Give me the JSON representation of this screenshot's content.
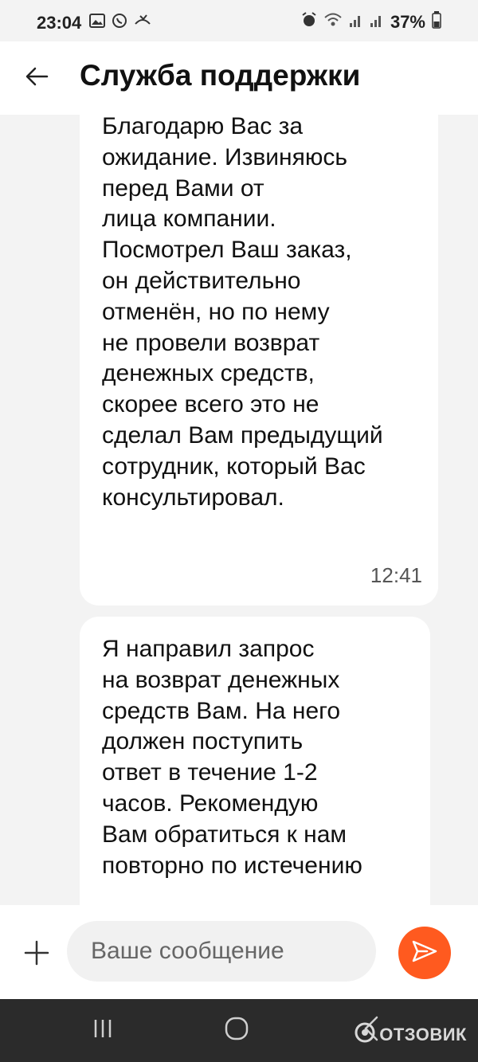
{
  "status_bar": {
    "time": "23:04",
    "battery": "37%",
    "icons_left": [
      "gallery-icon",
      "whatsapp-icon",
      "missed-call-icon"
    ],
    "icons_right": [
      "alarm-icon",
      "wifi-icon",
      "signal-icon",
      "signal-icon",
      "battery-icon"
    ]
  },
  "header": {
    "title": "Служба поддержки",
    "back_icon": "arrow-left-icon"
  },
  "messages": [
    {
      "text": "Благодарю Вас за\nожидание. Извиняюсь\nперед Вами от\nлица компании.\nПосмотрел Ваш заказ,\nон действительно\nотменён, но по нему\nне провели возврат\nденежных средств,\nскорее всего это не\nсделал Вам предыдущий\nсотрудник, который Вас\nконсультировал.",
      "time": "12:41"
    },
    {
      "text": "Я направил запрос\nна возврат денежных\nсредств Вам. На него\nдолжен поступить\nответ в течение 1-2\nчасов. Рекомендую\nВам обратиться к нам\nповторно по истечению",
      "time": ""
    }
  ],
  "input_bar": {
    "placeholder": "Ваше сообщение",
    "attach_icon": "plus-icon",
    "send_icon": "send-icon",
    "accent_color": "#ff5a1f"
  },
  "nav_bar": {
    "icons": [
      "recents-icon",
      "home-icon",
      "back-icon"
    ]
  },
  "watermark": {
    "text": "ОТЗОВИК"
  }
}
